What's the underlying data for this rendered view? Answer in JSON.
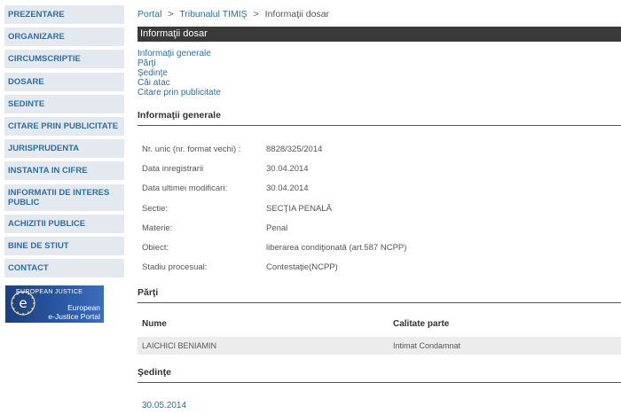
{
  "sidebar": {
    "items": [
      {
        "label": "PREZENTARE"
      },
      {
        "label": "ORGANIZARE"
      },
      {
        "label": "CIRCUMSCRIPTIE"
      },
      {
        "label": "DOSARE"
      },
      {
        "label": "SEDINTE"
      },
      {
        "label": "CITARE PRIN PUBLICITATE"
      },
      {
        "label": "JURISPRUDENTA"
      },
      {
        "label": "INSTANTA IN CIFRE"
      },
      {
        "label": "INFORMATII DE INTERES PUBLIC"
      },
      {
        "label": "ACHIZITII PUBLICE"
      },
      {
        "label": "BINE DE STIUT"
      },
      {
        "label": "CONTACT"
      }
    ],
    "logo": {
      "top": "European Justice",
      "bottom_line1": "European",
      "bottom_line2": "e-Justice Portal"
    }
  },
  "breadcrumb": {
    "portal": "Portal",
    "court": "Tribunalul TIMIŞ",
    "current": "Informaţii dosar",
    "sep": ">"
  },
  "page_title": "Informaţii dosar",
  "anchors": [
    "Informaţii generale",
    "Părţi",
    "Şedinţe",
    "Căi atac",
    "Citare prin publicitate"
  ],
  "general": {
    "heading": "Informaţii generale",
    "rows": [
      {
        "label": "Nr. unic (nr. format vechi) :",
        "value": "8828/325/2014"
      },
      {
        "label": "Data inregistrarii",
        "value": "30.04.2014"
      },
      {
        "label": "Data ultimei modificari:",
        "value": "30.04.2014"
      },
      {
        "label": "Sectie:",
        "value": "SECŢIA PENALĂ"
      },
      {
        "label": "Materie:",
        "value": "Penal"
      },
      {
        "label": "Obiect:",
        "value": "liberarea condiţionată (art.587 NCPP)"
      },
      {
        "label": "Stadiu procesual:",
        "value": "Contestaţie(NCPP)"
      }
    ]
  },
  "parti": {
    "heading": "Părţi",
    "columns": [
      "Nume",
      "Calitate parte"
    ],
    "rows": [
      {
        "name": "LAICHICI BENIAMIN",
        "role": "Intimat Condamnat"
      }
    ]
  },
  "sedinte": {
    "heading": "Şedinţe",
    "dates": [
      "30.05.2014"
    ]
  },
  "colors": {
    "link": "#2d6ea5",
    "nav_bg": "#e3e9ef",
    "title_bar": "#3a3a3a"
  }
}
